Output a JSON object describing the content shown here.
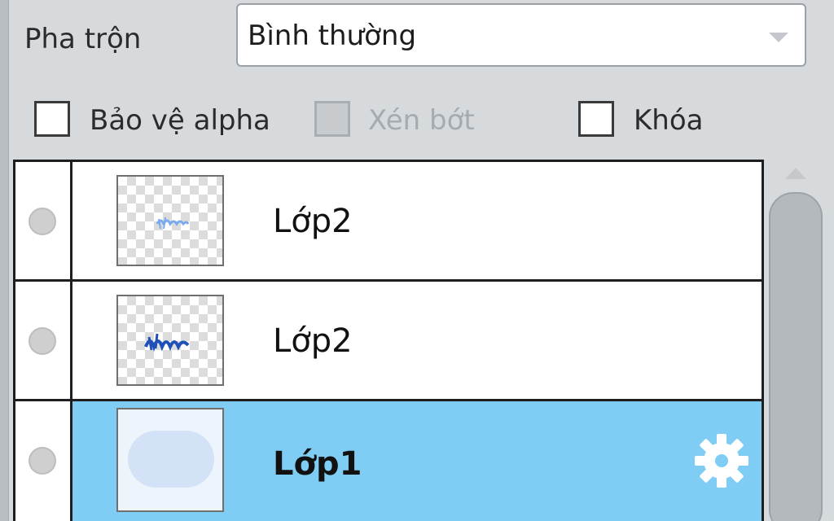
{
  "blend": {
    "label": "Pha trộn",
    "value": "Bình thường"
  },
  "options": {
    "protect_alpha": "Bảo vệ alpha",
    "clip": "Xén bớt",
    "lock": "Khóa"
  },
  "layers": [
    {
      "name": "Lớp2",
      "selected": false
    },
    {
      "name": "Lớp2",
      "selected": false
    },
    {
      "name": "Lớp1",
      "selected": true
    }
  ],
  "colors": {
    "selected_row": "#7fcdf4",
    "thumb_text": "#2f6fd6"
  },
  "icons": {
    "visibility": "visibility-dot-icon",
    "settings": "gear-icon",
    "dropdown": "chevron-down-icon",
    "scroll_up": "scroll-up-arrow-icon"
  }
}
